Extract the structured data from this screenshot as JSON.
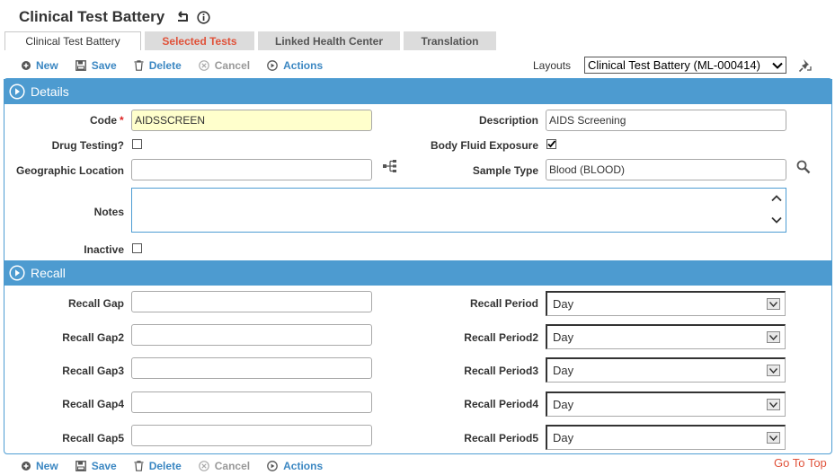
{
  "header": {
    "title": "Clinical Test Battery"
  },
  "tabs": [
    {
      "label": "Clinical Test Battery"
    },
    {
      "label": "Selected Tests"
    },
    {
      "label": "Linked Health Center"
    },
    {
      "label": "Translation"
    }
  ],
  "toolbar": {
    "new": "New",
    "save": "Save",
    "delete": "Delete",
    "cancel": "Cancel",
    "actions": "Actions"
  },
  "layouts": {
    "label": "Layouts",
    "value": "Clinical Test Battery (ML-000414)"
  },
  "details": {
    "heading": "Details",
    "code_label": "Code",
    "code_required": "*",
    "code_value": "AIDSSCREEN",
    "description_label": "Description",
    "description_value": "AIDS Screening",
    "drug_testing_label": "Drug Testing?",
    "body_fluid_label": "Body Fluid Exposure",
    "geo_label": "Geographic Location",
    "geo_value": "",
    "sample_type_label": "Sample Type",
    "sample_type_value": "Blood (BLOOD)",
    "notes_label": "Notes",
    "inactive_label": "Inactive"
  },
  "recall": {
    "heading": "Recall",
    "gaps": [
      {
        "label": "Recall Gap",
        "value": ""
      },
      {
        "label": "Recall Gap2",
        "value": ""
      },
      {
        "label": "Recall Gap3",
        "value": ""
      },
      {
        "label": "Recall Gap4",
        "value": ""
      },
      {
        "label": "Recall Gap5",
        "value": ""
      }
    ],
    "periods": [
      {
        "label": "Recall Period",
        "value": "Day"
      },
      {
        "label": "Recall Period2",
        "value": "Day"
      },
      {
        "label": "Recall Period3",
        "value": "Day"
      },
      {
        "label": "Recall Period4",
        "value": "Day"
      },
      {
        "label": "Recall Period5",
        "value": "Day"
      }
    ]
  },
  "footer": {
    "go_top": "Go To Top"
  },
  "colors": {
    "accent": "#4d9bd0",
    "link": "#3b87c2",
    "alert": "#e0523a",
    "required_bg": "#ffffcc"
  }
}
